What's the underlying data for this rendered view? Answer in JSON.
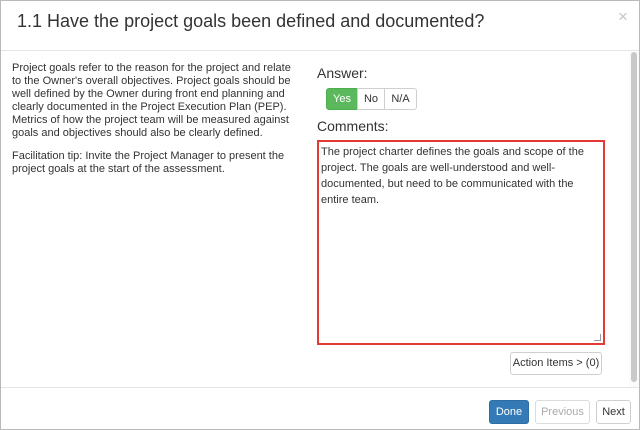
{
  "modal": {
    "title": "1.1 Have the project goals been defined and documented?",
    "close_symbol": "×"
  },
  "description": {
    "paragraph1": "Project goals refer to the reason for the project and relate to the Owner's overall objectives. Project goals should be well defined by the Owner during front end planning and clearly documented in the Project Execution Plan (PEP). Metrics of how the project team will be measured against goals and objectives should also be clearly defined.",
    "paragraph2": "Facilitation tip: Invite the Project Manager to present the project goals at the start of the assessment."
  },
  "answer": {
    "label": "Answer:",
    "options": [
      "Yes",
      "No",
      "N/A"
    ],
    "selected": "Yes",
    "selected_color": "#5cb85c"
  },
  "comments": {
    "label": "Comments:",
    "value": "The project charter defines the goals and scope of the project. The goals are well-understood and well-documented, but need to be communicated with the entire team.",
    "highlight_color": "#e53935"
  },
  "action_items": {
    "label": "Action Items > (0)"
  },
  "footer": {
    "done_label": "Done",
    "previous_label": "Previous",
    "next_label": "Next",
    "done_color": "#337ab7"
  },
  "icons": {
    "close": "close-icon"
  }
}
